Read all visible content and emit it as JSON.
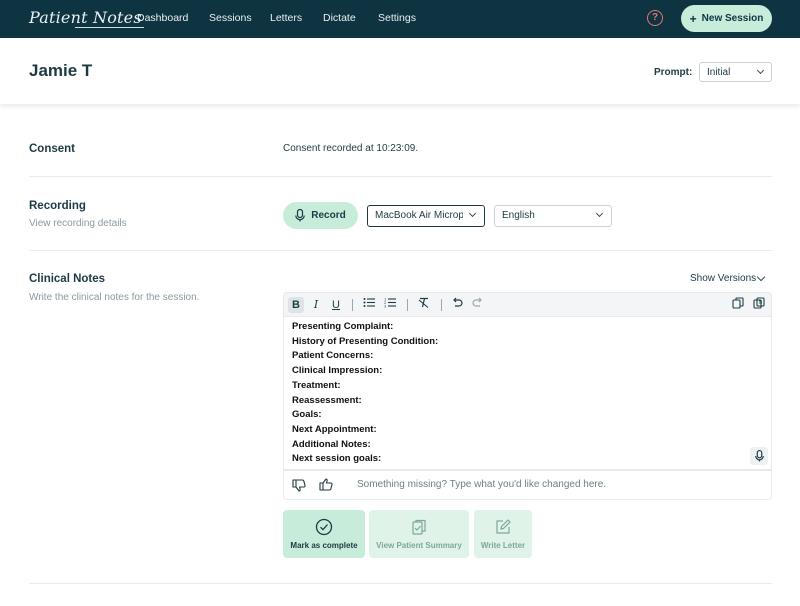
{
  "nav": {
    "brand": "Patient Notes",
    "items": [
      "Dashboard",
      "Sessions",
      "Letters",
      "Dictate",
      "Settings"
    ],
    "new_session": "New Session"
  },
  "header": {
    "patient_name": "Jamie T",
    "prompt_label": "Prompt:",
    "prompt_value": "Initial"
  },
  "consent": {
    "title": "Consent",
    "text": "Consent recorded at 10:23:09."
  },
  "recording": {
    "title": "Recording",
    "subtitle": "View recording details",
    "record_label": "Record",
    "microphone": "MacBook Air Microphone",
    "language": "English"
  },
  "clinical_notes": {
    "title": "Clinical Notes",
    "subtitle": "Write the clinical notes for the session.",
    "show_versions": "Show Versions",
    "lines": [
      "Presenting Complaint:",
      "History of Presenting Condition:",
      "Patient Concerns:",
      "Clinical Impression:",
      "Treatment:",
      "Reassessment:",
      "Goals:",
      "Next Appointment:",
      "Additional Notes:",
      "Next session goals:"
    ],
    "feedback_placeholder": "Something missing? Type what you'd like changed here."
  },
  "actions": {
    "mark_complete": "Mark as complete",
    "view_summary": "View Patient Summary",
    "write_letter": "Write Letter"
  },
  "colors": {
    "topbar": "#0e3441",
    "accent": "#c7ecd9",
    "help": "#e4756f"
  }
}
